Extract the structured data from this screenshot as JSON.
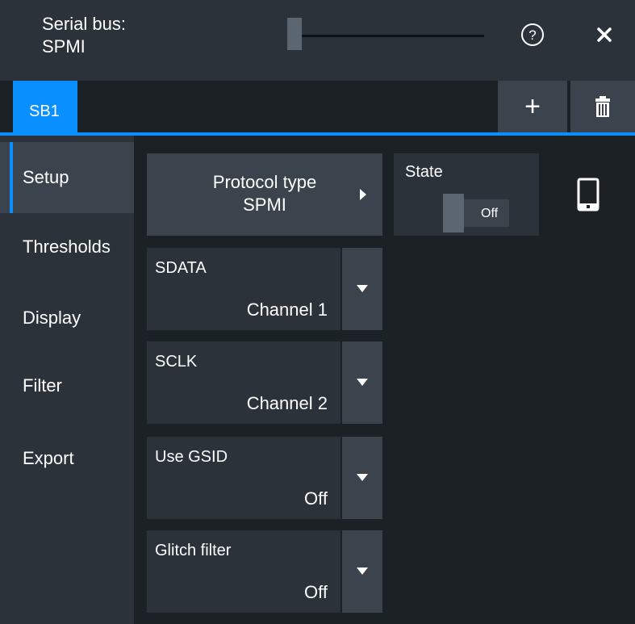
{
  "window": {
    "title": "Serial bus:\nSPMI"
  },
  "tabs": [
    {
      "label": "SB1",
      "active": true
    }
  ],
  "toolbar": {
    "add_label": "+",
    "delete_icon": "trash-icon"
  },
  "sidebar": {
    "items": [
      {
        "label": "Setup",
        "active": true
      },
      {
        "label": "Thresholds",
        "active": false
      },
      {
        "label": "Display",
        "active": false
      },
      {
        "label": "Filter",
        "active": false
      },
      {
        "label": "Export",
        "active": false
      }
    ]
  },
  "setup": {
    "protocol": {
      "label": "Protocol type",
      "value": "SPMI"
    },
    "state": {
      "label": "State",
      "value": "Off"
    },
    "fields": [
      {
        "label": "SDATA",
        "value": "Channel 1"
      },
      {
        "label": "SCLK",
        "value": "Channel 2"
      },
      {
        "label": "Use GSID",
        "value": "Off"
      },
      {
        "label": "Glitch filter",
        "value": "Off"
      }
    ]
  },
  "colors": {
    "accent": "#0a8fff",
    "background": "#1c2126",
    "panel": "#2b323a",
    "button": "#3b444d"
  }
}
